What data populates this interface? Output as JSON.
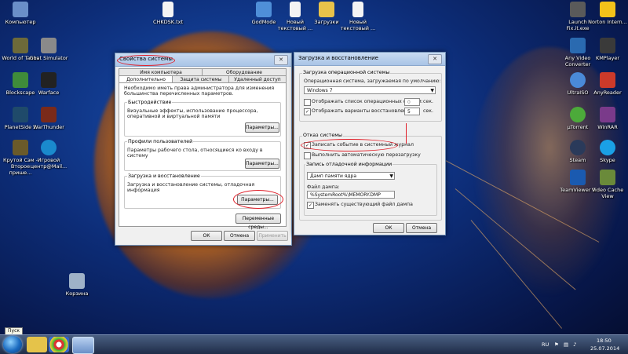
{
  "desktop_icons_left": [
    {
      "label": "Компьютер",
      "color": "#6a8fc8"
    },
    {
      "label": "World of Tanks",
      "color": "#6d6a3a"
    },
    {
      "label": "Goat Simulator",
      "color": "#8a8a8a"
    },
    {
      "label": "Blockscape",
      "color": "#3f8c3a"
    },
    {
      "label": "Warface",
      "color": "#222222"
    },
    {
      "label": "PlanetSide 2",
      "color": "#1f4a6a"
    },
    {
      "label": "WarThunder",
      "color": "#7a2a1a"
    },
    {
      "label": "Крутой Сэм - Второе прише...",
      "color": "#6a5a2a"
    },
    {
      "label": "Игровой центр@Mail...",
      "color": "#1a8acd"
    },
    {
      "label": "Корзина",
      "color": "#9fb2c8"
    }
  ],
  "desktop_icons_top": [
    {
      "label": "CHKDSK.txt",
      "color": "#f4f4f4"
    },
    {
      "label": "GodMode",
      "color": "#4f8fd8"
    },
    {
      "label": "Новый текстовый ...",
      "color": "#f4f4f4"
    },
    {
      "label": "Загрузки",
      "color": "#e8c24a"
    },
    {
      "label": "Новый текстовый ...",
      "color": "#f4f4f4"
    }
  ],
  "desktop_icons_right": [
    {
      "label": "Launch Fix.it.exe",
      "color": "#5a5a5a"
    },
    {
      "label": "Norton Intern...",
      "color": "#f2c21a"
    },
    {
      "label": "Any Video Converter",
      "color": "#2a6ab0"
    },
    {
      "label": "KMPlayer",
      "color": "#3a3a3a"
    },
    {
      "label": "UltraISO",
      "color": "#4a8ad8"
    },
    {
      "label": "AnyReader",
      "color": "#cc3a2a"
    },
    {
      "label": "µTorrent",
      "color": "#4caa3a"
    },
    {
      "label": "WinRAR",
      "color": "#7a3a8a"
    },
    {
      "label": "Steam",
      "color": "#2a3a5a"
    },
    {
      "label": "Skype",
      "color": "#1aa0e6"
    },
    {
      "label": "TeamViewer 9",
      "color": "#1a5ab0"
    },
    {
      "label": "Video Cache View",
      "color": "#6a8a3a"
    }
  ],
  "sys_props": {
    "title": "Свойства системы",
    "close": "✕",
    "tabs_row1": [
      "Имя компьютера",
      "Оборудование"
    ],
    "tabs_row2": [
      "Дополнительно",
      "Защита системы",
      "Удаленный доступ"
    ],
    "admin_note": "Необходимо иметь права администратора для изменения большинства перечисленных параметров.",
    "perf_title": "Быстродействие",
    "perf_text": "Визуальные эффекты, использование процессора, оперативной и виртуальной памяти",
    "perf_btn": "Параметры...",
    "profiles_title": "Профили пользователей",
    "profiles_text": "Параметры рабочего стола, относящиеся ко входу в систему",
    "profiles_btn": "Параметры...",
    "startup_title": "Загрузка и восстановление",
    "startup_text": "Загрузка и восстановление системы, отладочная информация",
    "startup_btn": "Параметры...",
    "env_btn": "Переменные среды...",
    "ok": "ОК",
    "cancel": "Отмена",
    "apply": "Применить"
  },
  "boot_dialog": {
    "title": "Загрузка и восстановление",
    "close": "✕",
    "os_group": "Загрузка операционной системы",
    "default_os_label": "Операционная система, загружаемая по умолчанию:",
    "default_os_value": "Windows 7",
    "show_list_label": "Отображать список операционных систем:",
    "show_list_value": "0",
    "show_recovery_label": "Отображать варианты восстановления:",
    "show_recovery_value": "5",
    "sec_unit": "сек.",
    "failure_group": "Отказ системы",
    "write_event_label": "Записать событие в системный журнал",
    "auto_restart_label": "Выполнить автоматическую перезагрузку",
    "debug_group": "Запись отладочной информации",
    "debug_type": "Дамп памяти ядра",
    "dump_file_label": "Файл дампа:",
    "dump_file_value": "%SystemRoot%\\MEMORY.DMP",
    "overwrite_label": "Заменять существующий файл дампа",
    "ok": "ОК",
    "cancel": "Отмена"
  },
  "taskbar": {
    "tooltip": "Пуск",
    "lang": "RU",
    "time": "18:50",
    "date": "25.07.2014"
  }
}
